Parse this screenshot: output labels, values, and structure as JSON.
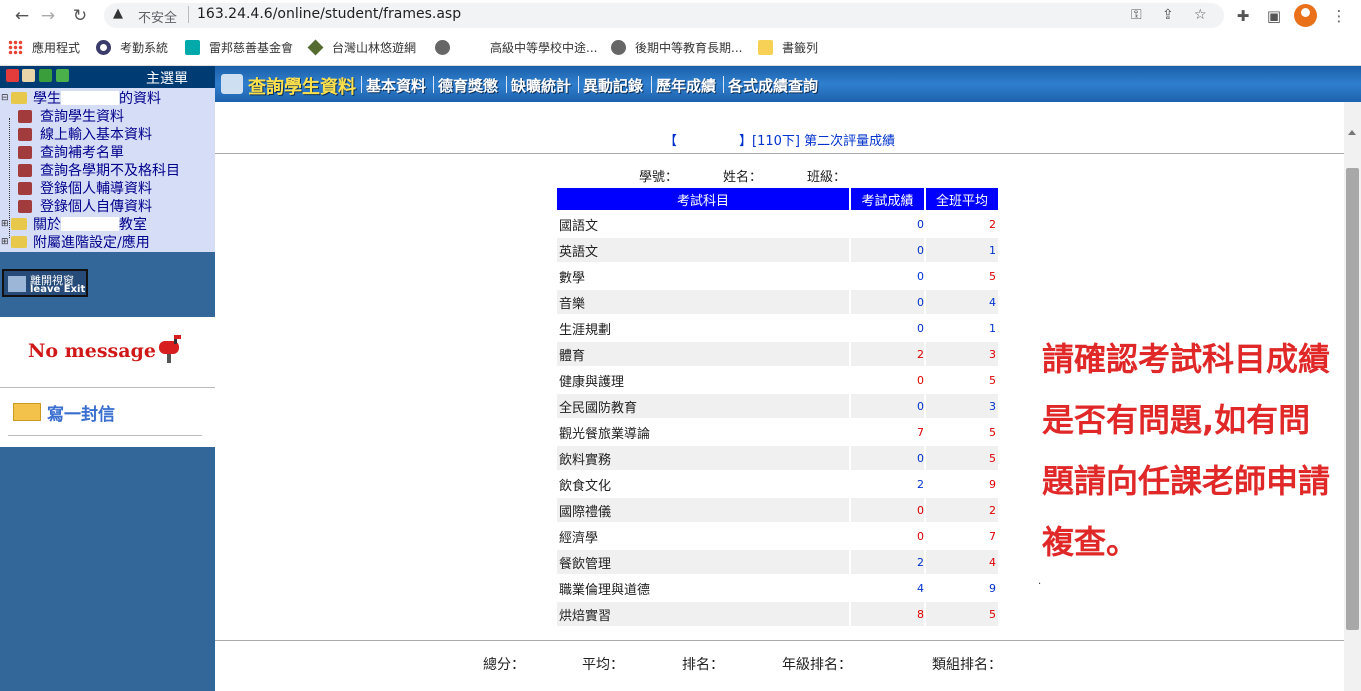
{
  "browser": {
    "security_label": "不安全",
    "url": "163.24.4.6/online/student/frames.asp",
    "bookmarks": [
      "應用程式",
      "考勤系統",
      "雷邦慈善基金會",
      "台灣山林悠遊網",
      "",
      "高級中等學校中途...",
      "後期中等教育長期...",
      "書籤列"
    ]
  },
  "left_menu": {
    "title": "主選單",
    "root_label_prefix": "學生",
    "root_label_suffix": "的資料",
    "items": [
      "查詢學生資料",
      "線上輸入基本資料",
      "查詢補考名單",
      "查詢各學期不及格科目",
      "登錄個人輔導資料",
      "登錄個人自傳資料"
    ],
    "about_prefix": "關於",
    "about_suffix": "教室",
    "advanced": "附屬進階設定/應用",
    "exit_zh": "離開視窗",
    "exit_en": "leave Exit",
    "no_message": "No message",
    "write_letter": "寫一封信"
  },
  "top_nav": {
    "current": "查詢學生資料",
    "items": [
      "基本資料",
      "德育獎懲",
      "缺曠統計",
      "異動記錄",
      "歷年成績",
      "各式成績查詢"
    ]
  },
  "report": {
    "bracket_open": "【",
    "bracket_close": "】",
    "title": "[110下] 第二次評量成績",
    "student_no_label": "學號：",
    "name_label": "姓名：",
    "class_label": "班級：",
    "columns": [
      "考試科目",
      "考試成績",
      "全班平均"
    ],
    "rows": [
      {
        "subject": "國語文",
        "score": "0",
        "score_color": "blue",
        "avg": "2",
        "avg_color": "red"
      },
      {
        "subject": "英語文",
        "score": "0",
        "score_color": "blue",
        "avg": "1",
        "avg_color": "blue"
      },
      {
        "subject": "數學",
        "score": "0",
        "score_color": "blue",
        "avg": "5",
        "avg_color": "red"
      },
      {
        "subject": "音樂",
        "score": "0",
        "score_color": "blue",
        "avg": "4",
        "avg_color": "blue"
      },
      {
        "subject": "生涯規劃",
        "score": "0",
        "score_color": "blue",
        "avg": "1",
        "avg_color": "blue"
      },
      {
        "subject": "體育",
        "score": "2",
        "score_color": "red",
        "avg": "3",
        "avg_color": "red"
      },
      {
        "subject": "健康與護理",
        "score": "0",
        "score_color": "red",
        "avg": "5",
        "avg_color": "red"
      },
      {
        "subject": "全民國防教育",
        "score": "0",
        "score_color": "blue",
        "avg": "3",
        "avg_color": "blue"
      },
      {
        "subject": "觀光餐旅業導論",
        "score": "7",
        "score_color": "red",
        "avg": "5",
        "avg_color": "red"
      },
      {
        "subject": "飲料實務",
        "score": "0",
        "score_color": "blue",
        "avg": "5",
        "avg_color": "red"
      },
      {
        "subject": "飲食文化",
        "score": "2",
        "score_color": "blue",
        "avg": "9",
        "avg_color": "red"
      },
      {
        "subject": "國際禮儀",
        "score": "0",
        "score_color": "red",
        "avg": "2",
        "avg_color": "red"
      },
      {
        "subject": "經濟學",
        "score": "0",
        "score_color": "red",
        "avg": "7",
        "avg_color": "red"
      },
      {
        "subject": "餐飲管理",
        "score": "2",
        "score_color": "blue",
        "avg": "4",
        "avg_color": "red"
      },
      {
        "subject": "職業倫理與道德",
        "score": "4",
        "score_color": "blue",
        "avg": "9",
        "avg_color": "blue"
      },
      {
        "subject": "烘焙實習",
        "score": "8",
        "score_color": "red",
        "avg": "5",
        "avg_color": "red"
      }
    ],
    "note": "請確認考試科目成績是否有問題,如有問題請向任課老師申請複查。",
    "note_dot": ".",
    "totals": {
      "total": "總分：",
      "average": "平均：",
      "rank": "排名：",
      "grade_rank": "年級排名：",
      "group_rank": "類組排名："
    }
  },
  "colors": {
    "nav_blue": "#1b5fa8",
    "header_blue": "#0000ff",
    "sidebar_bg": "#336699",
    "tree_bg": "#d6ddf6",
    "note_red": "#e02828"
  }
}
